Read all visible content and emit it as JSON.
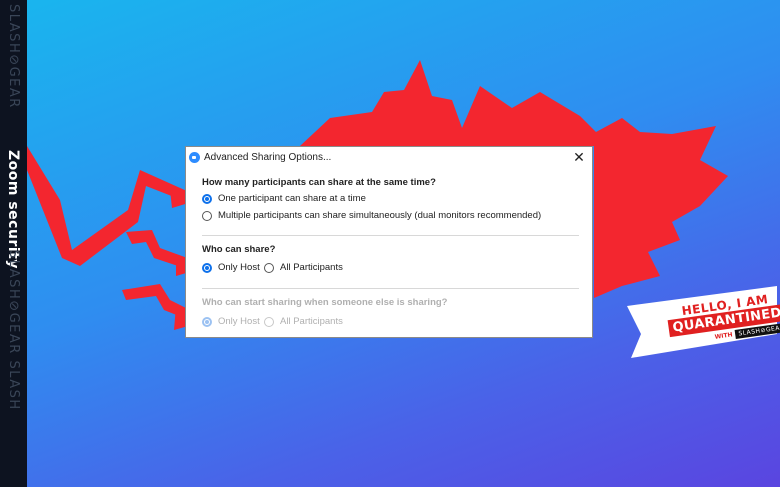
{
  "background": {
    "gradient_colors": [
      "#19b6ee",
      "#4a62e8",
      "#5a45e0"
    ],
    "burst_color": "#f3262f",
    "watermark_top": "SLASH⊘GEAR",
    "watermark_bottom": "SLASH⊘GEAR SLASH",
    "side_title": "Zoom security"
  },
  "dialog": {
    "title": "Advanced Sharing Options...",
    "close_icon": "close-icon",
    "sections": [
      {
        "question": "How many participants can share at the same time?",
        "options": [
          {
            "label": "One participant can share at a time",
            "checked": true
          },
          {
            "label": "Multiple participants can share simultaneously (dual monitors recommended)",
            "checked": false
          }
        ]
      },
      {
        "question": "Who can share?",
        "options": [
          {
            "label": "Only Host",
            "checked": true
          },
          {
            "label": "All Participants",
            "checked": false
          }
        ]
      },
      {
        "question": "Who can start sharing when someone else is sharing?",
        "disabled": true,
        "options": [
          {
            "label": "Only Host",
            "checked": true
          },
          {
            "label": "All Participants",
            "checked": false
          }
        ]
      }
    ]
  },
  "sticker": {
    "line1": "HELLO, I AM",
    "line2": "QUARANTINED",
    "with": "WITH",
    "brand": "SLASH⊘GEAR"
  }
}
